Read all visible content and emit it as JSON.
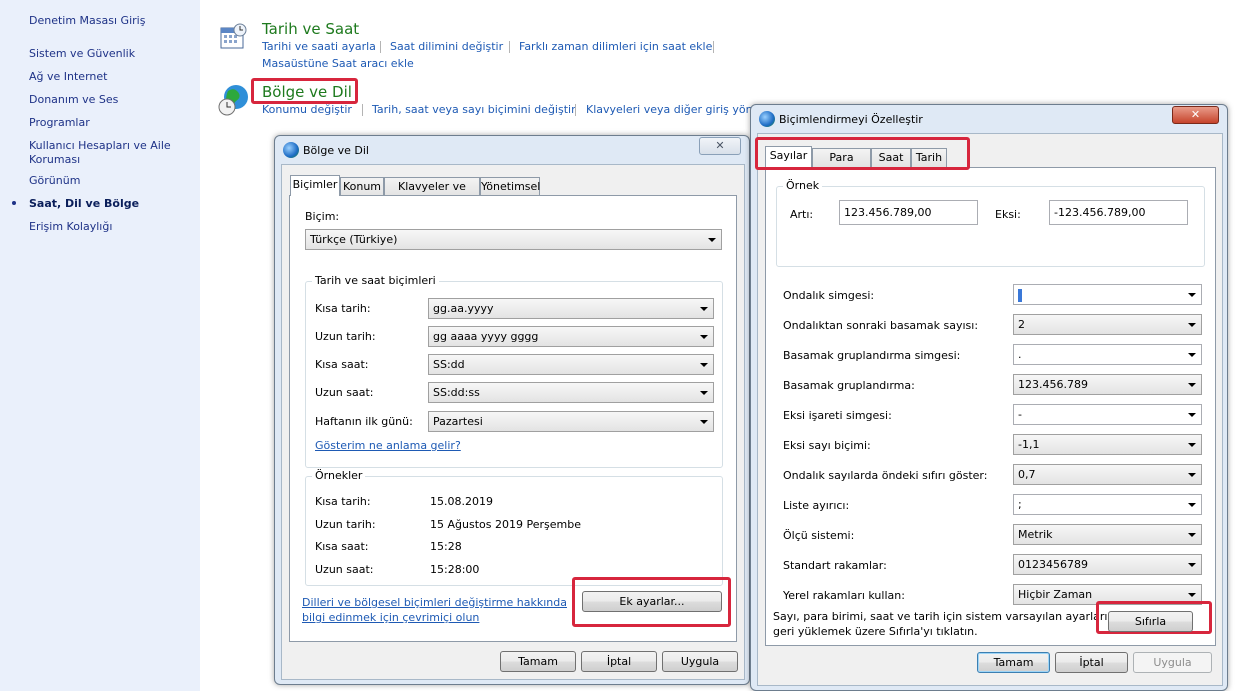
{
  "sidebar": {
    "items": [
      {
        "label": "Denetim Masası Giriş"
      },
      {
        "label": "Sistem ve Güvenlik"
      },
      {
        "label": "Ağ ve Internet"
      },
      {
        "label": "Donanım ve Ses"
      },
      {
        "label": "Programlar"
      },
      {
        "label": "Kullanıcı Hesapları ve Aile Koruması"
      },
      {
        "label": "Görünüm"
      },
      {
        "label": "Saat, Dil ve Bölge"
      },
      {
        "label": "Erişim Kolaylığı"
      }
    ],
    "active_index": 7
  },
  "datetime": {
    "title": "Tarih ve Saat",
    "links": [
      "Tarihi ve saati ayarla",
      "Saat dilimini değiştir",
      "Farklı zaman dilimleri için saat ekle",
      "Masaüstüne Saat aracı ekle"
    ],
    "icon": "calendar-clock-icon"
  },
  "region": {
    "title": "Bölge ve Dil",
    "links": [
      "Konumu değiştir",
      "Tarih, saat veya sayı biçimini değiştir",
      "Klavyeleri veya diğer giriş yönte"
    ],
    "icon": "globe-clock-icon"
  },
  "region_dialog": {
    "title": "Bölge ve Dil",
    "close": "✕",
    "tabs": [
      "Biçimler",
      "Konum",
      "Klavyeler ve Diller",
      "Yönetimsel"
    ],
    "active_tab": 0,
    "format_label": "Biçim:",
    "format_value": "Türkçe (Türkiye)",
    "datetime_group": "Tarih ve saat biçimleri",
    "rows": [
      {
        "label": "Kısa tarih:",
        "value": "gg.aa.yyyy"
      },
      {
        "label": "Uzun tarih:",
        "value": "gg aaaa yyyy gggg"
      },
      {
        "label": "Kısa saat:",
        "value": "SS:dd"
      },
      {
        "label": "Uzun saat:",
        "value": "SS:dd:ss"
      },
      {
        "label": "Haftanın ilk günü:",
        "value": "Pazartesi"
      }
    ],
    "notation_link": "Gösterim ne anlama gelir?",
    "examples_group": "Örnekler",
    "examples": [
      {
        "label": "Kısa tarih:",
        "value": "15.08.2019"
      },
      {
        "label": "Uzun tarih:",
        "value": "15 Ağustos 2019 Perşembe"
      },
      {
        "label": "Kısa saat:",
        "value": "15:28"
      },
      {
        "label": "Uzun saat:",
        "value": "15:28:00"
      }
    ],
    "online_link_1": "Dilleri ve bölgesel biçimleri değiştirme hakkında",
    "online_link_2": "bilgi edinmek için çevrimiçi olun",
    "advanced_button": "Ek ayarlar...",
    "ok": "Tamam",
    "cancel": "İptal",
    "apply": "Uygula"
  },
  "customize_dialog": {
    "title": "Biçimlendirmeyi Özelleştir",
    "close": "✕",
    "tabs": [
      "Sayılar",
      "Para Birimi",
      "Saat",
      "Tarih"
    ],
    "active_tab": 0,
    "example_group": "Örnek",
    "positive_label": "Artı:",
    "positive_value": "123.456.789,00",
    "negative_label": "Eksi:",
    "negative_value": "-123.456.789,00",
    "settings": [
      {
        "label": "Ondalık simgesi:",
        "value": ",",
        "editable": true
      },
      {
        "label": "Ondalıktan sonraki basamak sayısı:",
        "value": "2",
        "editable": false
      },
      {
        "label": "Basamak gruplandırma simgesi:",
        "value": ".",
        "editable": true
      },
      {
        "label": "Basamak gruplandırma:",
        "value": "123.456.789",
        "editable": false
      },
      {
        "label": "Eksi işareti simgesi:",
        "value": "-",
        "editable": true
      },
      {
        "label": "Eksi sayı biçimi:",
        "value": "-1,1",
        "editable": false
      },
      {
        "label": "Ondalık sayılarda öndeki sıfırı göster:",
        "value": "0,7",
        "editable": false
      },
      {
        "label": "Liste ayırıcı:",
        "value": ";",
        "editable": true
      },
      {
        "label": "Ölçü sistemi:",
        "value": "Metrik",
        "editable": false
      },
      {
        "label": "Standart rakamlar:",
        "value": "0123456789",
        "editable": false
      },
      {
        "label": "Yerel rakamları kullan:",
        "value": "Hiçbir Zaman",
        "editable": false
      }
    ],
    "reset_note_1": "Sayı, para birimi, saat ve tarih için sistem varsayılan ayarlarını",
    "reset_note_2": "geri yüklemek üzere Sıfırla'yı tıklatın.",
    "reset_button": "Sıfırla",
    "ok": "Tamam",
    "cancel": "İptal",
    "apply": "Uygula"
  },
  "colors": {
    "highlight": "#d7263d",
    "link": "#1e5ab4",
    "section_title": "#1e7a1e"
  }
}
